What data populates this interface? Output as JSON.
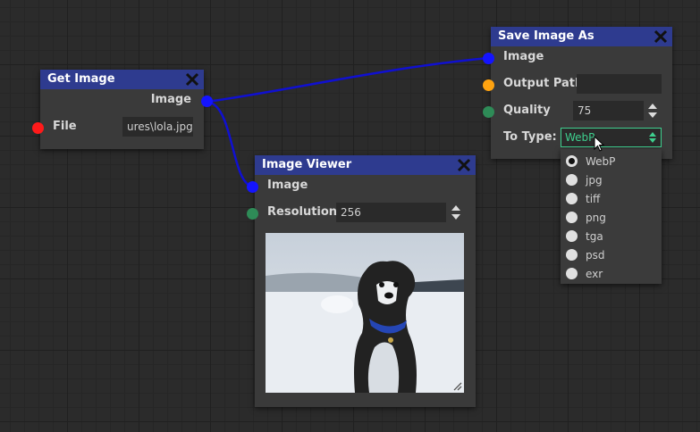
{
  "colors": {
    "header_blue": "#2e3b8f",
    "port_image": "#1414ff",
    "port_file": "#ff1a1a",
    "port_path": "#ffa310",
    "port_number": "#2e8b57",
    "select_accent": "#3ecf8e",
    "wire": "#1010d0"
  },
  "get_image": {
    "title": "Get Image",
    "out_image_label": "Image",
    "file_label": "File",
    "file_value": "ures\\lola.jpg"
  },
  "image_viewer": {
    "title": "Image Viewer",
    "in_image_label": "Image",
    "resolution_label": "Resolution",
    "resolution_value": "256",
    "preview_icon": "photo-of-dog-in-snow"
  },
  "save_image": {
    "title": "Save Image As",
    "in_image_label": "Image",
    "output_path_label": "Output Path",
    "output_path_value": "",
    "quality_label": "Quality",
    "quality_value": "75",
    "to_type_label": "To Type:",
    "to_type_value": "WebP",
    "options": [
      "WebP",
      "jpg",
      "tiff",
      "png",
      "tga",
      "psd",
      "exr"
    ],
    "selected_index": 0
  },
  "icons": {
    "close": "close-icon",
    "spinner": "spinner-arrows-icon",
    "select_arrows": "updown-arrows-icon",
    "cursor": "mouse-pointer-icon",
    "resize": "resize-grip-icon"
  }
}
